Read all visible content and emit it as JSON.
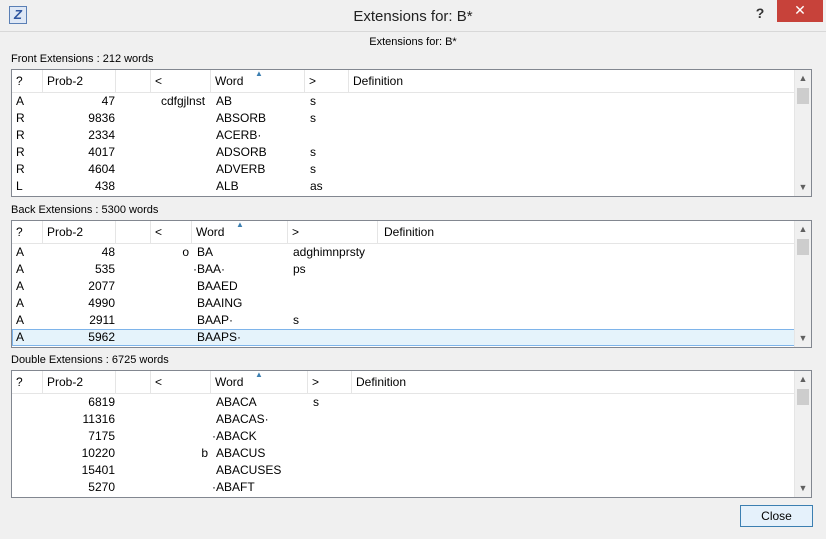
{
  "window": {
    "title": "Extensions for: B*",
    "help_label": "?",
    "close_label": "✕"
  },
  "header": {
    "label": "Extensions for: B*"
  },
  "columns": {
    "q": "?",
    "prob": "Prob-2",
    "front": "<",
    "word": "Word",
    "back": ">",
    "definition": "Definition"
  },
  "front": {
    "label": "Front Extensions : 212 words",
    "rows": [
      {
        "q": "A",
        "prob": "47",
        "front": "cdfgjlnst",
        "word": "AB",
        "back": "s"
      },
      {
        "q": "R",
        "prob": "9836",
        "front": "",
        "word": "ABSORB",
        "back": "s"
      },
      {
        "q": "R",
        "prob": "2334",
        "front": "",
        "word": "ACERB·",
        "back": ""
      },
      {
        "q": "R",
        "prob": "4017",
        "front": "",
        "word": "ADSORB",
        "back": "s"
      },
      {
        "q": "R",
        "prob": "4604",
        "front": "",
        "word": "ADVERB",
        "back": "s"
      },
      {
        "q": "L",
        "prob": "438",
        "front": "",
        "word": "ALB",
        "back": "as"
      }
    ]
  },
  "back": {
    "label": "Back Extensions : 5300 words",
    "rows": [
      {
        "q": "A",
        "prob": "48",
        "front": "o",
        "word": "BA",
        "back": "adghimnprsty"
      },
      {
        "q": "A",
        "prob": "535",
        "front": "",
        "word": "·BAA·",
        "back": "ps"
      },
      {
        "q": "A",
        "prob": "2077",
        "front": "",
        "word": "BAAED",
        "back": ""
      },
      {
        "q": "A",
        "prob": "4990",
        "front": "",
        "word": "BAAING",
        "back": ""
      },
      {
        "q": "A",
        "prob": "2911",
        "front": "",
        "word": "BAAP·",
        "back": "s"
      },
      {
        "q": "A",
        "prob": "5962",
        "front": "",
        "word": "BAAPS·",
        "back": ""
      }
    ]
  },
  "double": {
    "label": "Double Extensions : 6725 words",
    "rows": [
      {
        "q": "",
        "prob": "6819",
        "front": "",
        "word": "ABACA",
        "back": "s"
      },
      {
        "q": "",
        "prob": "11316",
        "front": "",
        "word": "ABACAS·",
        "back": ""
      },
      {
        "q": "",
        "prob": "7175",
        "front": "",
        "word": "·ABACK",
        "back": ""
      },
      {
        "q": "",
        "prob": "10220",
        "front": "b",
        "word": "ABACUS",
        "back": ""
      },
      {
        "q": "",
        "prob": "15401",
        "front": "",
        "word": "ABACUSES",
        "back": ""
      },
      {
        "q": "",
        "prob": "5270",
        "front": "",
        "word": "·ABAFT",
        "back": ""
      }
    ]
  },
  "footer": {
    "close_label": "Close"
  }
}
